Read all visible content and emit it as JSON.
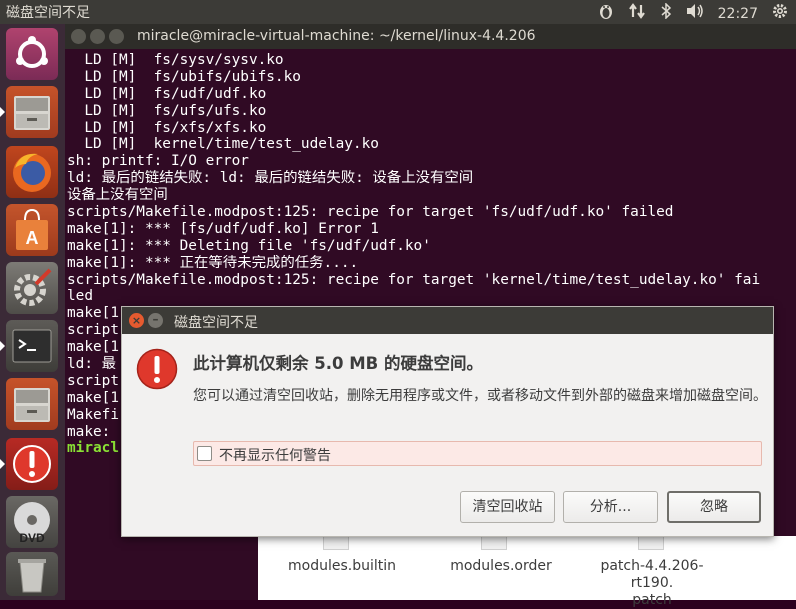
{
  "top_panel": {
    "title": "磁盘空间不足",
    "time": "22:27",
    "indicators": [
      "keyboard-penguin-icon",
      "network-arrows-icon",
      "bluetooth-icon",
      "volume-icon",
      "gear-icon"
    ]
  },
  "launcher": {
    "items": [
      "ubuntu-dash-icon",
      "files-icon",
      "firefox-icon",
      "software-center-icon",
      "system-settings-icon",
      "terminal-icon",
      "files-icon",
      "warning-icon",
      "dvd-icon",
      "trash-icon"
    ]
  },
  "terminal": {
    "title": "miracle@miracle-virtual-machine: ~/kernel/linux-4.4.206",
    "lines": [
      "  LD [M]  fs/sysv/sysv.ko",
      "  LD [M]  fs/ubifs/ubifs.ko",
      "  LD [M]  fs/udf/udf.ko",
      "  LD [M]  fs/ufs/ufs.ko",
      "  LD [M]  fs/xfs/xfs.ko",
      "  LD [M]  kernel/time/test_udelay.ko",
      "sh: printf: I/O error",
      "ld: 最后的链结失败: ld: 最后的链结失败: 设备上没有空间",
      "设备上没有空间",
      "scripts/Makefile.modpost:125: recipe for target 'fs/udf/udf.ko' failed",
      "make[1]: *** [fs/udf/udf.ko] Error 1",
      "make[1]: *** Deleting file 'fs/udf/udf.ko'",
      "make[1]: *** 正在等待未完成的任务....",
      "scripts/Makefile.modpost:125: recipe for target 'kernel/time/test_udelay.ko' fai",
      "led",
      "make[1",
      "script",
      "make[1",
      "ld: 最",
      "script",
      "make[1",
      "Makefi",
      "make: "
    ],
    "prompt": "miracl"
  },
  "files": {
    "items": [
      {
        "name": "modules.builtin"
      },
      {
        "name": "modules.order"
      },
      {
        "name": "patch-4.4.206-rt190.",
        "name2": "patch"
      }
    ]
  },
  "dialog": {
    "title": "磁盘空间不足",
    "heading": "此计算机仅剩余 5.0 MB 的硬盘空间。",
    "body": "您可以通过清空回收站，删除无用程序或文件，或者移动文件到外部的磁盘来增加磁盘空间。",
    "checkbox_label": "不再显示任何警告",
    "checkbox_checked": false,
    "buttons": {
      "empty_trash": "清空回收站",
      "analyze": "分析...",
      "ignore": "忽略"
    },
    "colors": {
      "warning_red": "#df382c",
      "close_orange": "#e65a2f"
    }
  }
}
